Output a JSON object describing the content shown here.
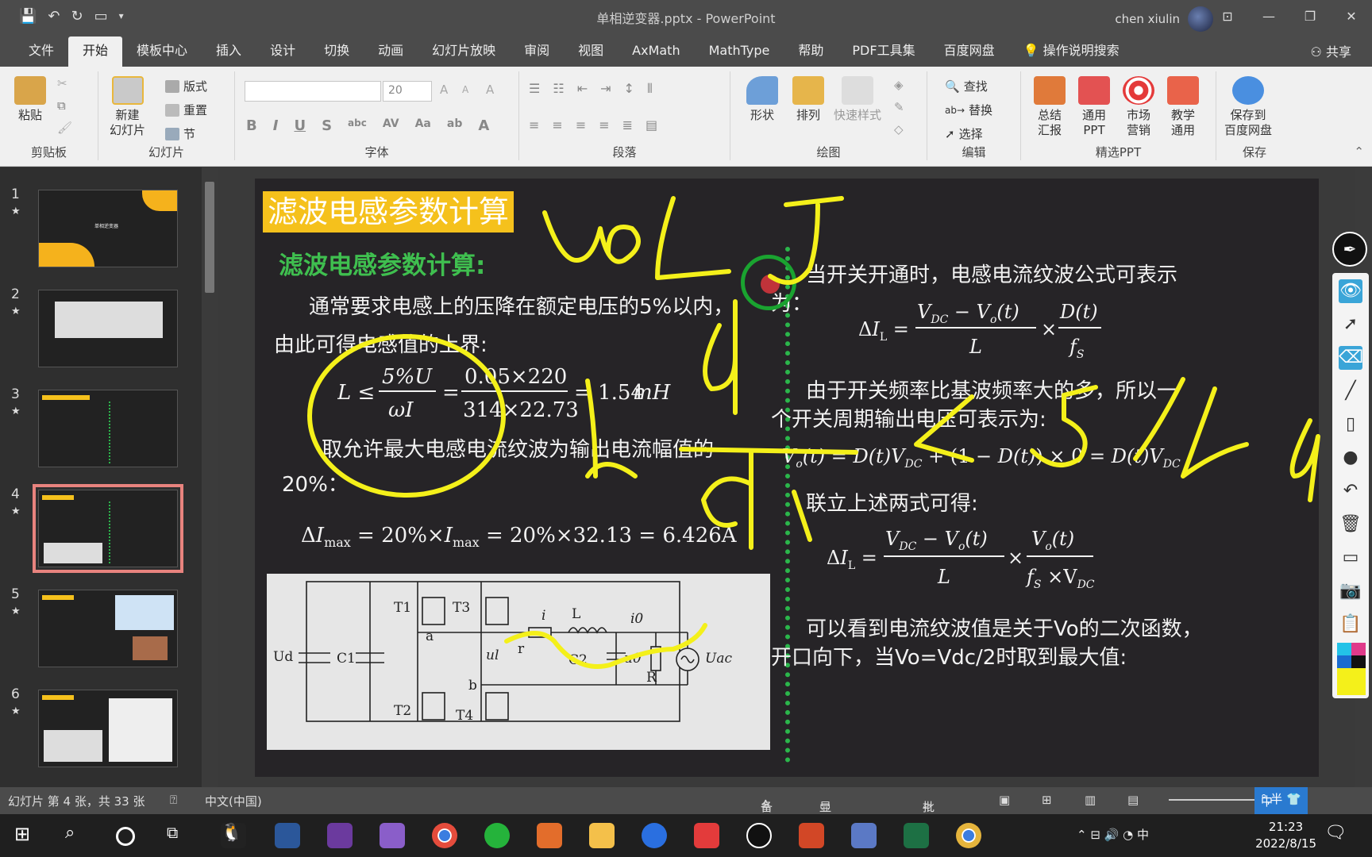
{
  "titlebar": {
    "title": "单相逆变器.pptx  -  PowerPoint",
    "user": "chen xiulin"
  },
  "menu": {
    "tabs": [
      "文件",
      "开始",
      "模板中心",
      "插入",
      "设计",
      "切换",
      "动画",
      "幻灯片放映",
      "审阅",
      "视图",
      "AxMath",
      "MathType",
      "帮助",
      "PDF工具集",
      "百度网盘",
      "操作说明搜索"
    ],
    "share": "共享"
  },
  "ribbon": {
    "paste": "粘贴",
    "clipboard": "剪贴板",
    "new_slide_1": "新建",
    "new_slide_2": "幻灯片",
    "layout": "版式",
    "reset": "重置",
    "section": "节",
    "slides_group": "幻灯片",
    "font_size": "20",
    "font_group": "字体",
    "paragraph_group": "段落",
    "shape": "形状",
    "arrange": "排列",
    "quick_style": "快速样式",
    "drawing_group": "绘图",
    "find": "查找",
    "replace": "替换",
    "select": "选择",
    "edit_group": "编辑",
    "summary_1": "总结",
    "summary_2": "汇报",
    "general_1": "通用",
    "general_2": "PPT",
    "market_1": "市场",
    "market_2": "营销",
    "teach_1": "教学",
    "teach_2": "通用",
    "premium_group": "精选PPT",
    "save_baidu_1": "保存到",
    "save_baidu_2": "百度网盘",
    "save_group": "保存"
  },
  "thumbnails": [
    "1",
    "2",
    "3",
    "4",
    "5",
    "6"
  ],
  "thumb1_title": "单相逆变器",
  "slide": {
    "title": "滤波电感参数计算",
    "subtitle": "滤波电感参数计算:",
    "left_p1_a": "通常要求电感上的压降在额定电压的5%以内，",
    "left_p1_b": "由此可得电感值的上界:",
    "formula1": "L ≤ 5%U / ωI = 0.05×220 / 314×22.73 = 1.54mH",
    "left_p2_a": "取允许最大电感电流纹波为输出电流幅值的",
    "left_p2_b": "20%：",
    "formula2": "ΔImax = 20%×Imax = 20%×32.13 = 6.426A",
    "right_p1_a": "当开关开通时，电感电流纹波公式可表示",
    "right_p1_b": "为：",
    "formula3": "ΔIL = (VDC − Vo(t)) / L × D(t) / fS",
    "right_p2_a": "由于开关频率比基波频率大的多，所以一",
    "right_p2_b": "个开关周期输出电压可表示为:",
    "formula4": "Vo(t) = D(t)VDC + (1 − D(t)) × 0 = D(t)VDC",
    "right_p3": "联立上述两式可得:",
    "formula5": "ΔIL = (VDC − Vo(t)) / L × Vo(t) / (fS × VDC)",
    "right_p4_a": "可以看到电流纹波值是关于Vo的二次函数，",
    "right_p4_b": "开口向下，当Vo=Vdc/2时取到最大值:"
  },
  "circuit": {
    "labels": [
      "Ud",
      "C1",
      "T1",
      "T3",
      "T2",
      "T4",
      "a",
      "b",
      "L",
      "r",
      "i",
      "i0",
      "ul",
      "C2",
      "u0",
      "R",
      "Uac"
    ]
  },
  "status": {
    "slide_info": "幻灯片 第 4 张，共 33 张",
    "lang": "中文(中国)",
    "notes": "备注",
    "display": "显示器设置",
    "comments": "批注"
  },
  "taskbar": {
    "time": "21:23",
    "date": "2022/8/15",
    "ime": "中"
  },
  "colors": {
    "accent_yellow": "#f5c11c",
    "subtitle_green": "#3fbf4f",
    "ink_yellow": "#f4f01a",
    "divider_green": "#2bb64b"
  }
}
